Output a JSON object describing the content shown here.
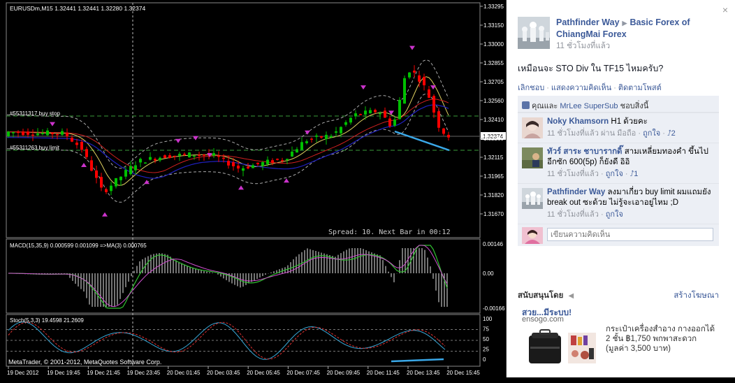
{
  "chart": {
    "header": "EURUSDm,M15  1.32441 1.32441 1.32280 1.32374",
    "price_labels": [
      "1.33295",
      "1.33150",
      "1.33000",
      "1.32855",
      "1.32705",
      "1.32560",
      "1.32410",
      "1.32374",
      "1.32260",
      "1.32115",
      "1.31965",
      "1.31820",
      "1.31670"
    ],
    "current_price": "1.32374",
    "buy_stop_label": "#55311317 buy stop",
    "buy_limit_label": "#55311263 buy limit",
    "spread_text": "Spread: 10. Next Bar in 00:12",
    "macd_label": "MACD(15,35,9) 0.000599 0.001099  =>MA(3) 0.000765",
    "macd_scale": [
      "0.00146",
      "0.00",
      "-0.00166"
    ],
    "stoch_label": "Stoch(5,3,3) 19.4598 21.2609",
    "stoch_scale": [
      "100",
      "75",
      "50",
      "25",
      "0"
    ],
    "copyright": "MetaTrader, © 2001-2012, MetaQuotes Software Corp.",
    "time_labels": [
      "19 Dec 2012",
      "19 Dec 19:45",
      "19 Dec 21:45",
      "19 Dec 23:45",
      "20 Dec 01:45",
      "20 Dec 03:45",
      "20 Dec 05:45",
      "20 Dec 07:45",
      "20 Dec 09:45",
      "20 Dec 11:45",
      "20 Dec 13:45",
      "20 Dec 15:45"
    ],
    "colors": {
      "bull": "#00c000",
      "bear": "#ff0000",
      "fractal": "#cc33cc",
      "level": "#3a9b3a",
      "trend": "#3aa8e8",
      "ma_yellow": "#e0d060",
      "ma_red": "#d02020",
      "ma_blue": "#2020c0"
    }
  },
  "fb": {
    "close_glyph": "×",
    "page_name": "Pathfinder Way",
    "arrow_glyph": "▶",
    "group_name": "Basic Forex of ChiangMai Forex",
    "post_time": "11 ชั่วโมงที่แล้ว",
    "post_text": "เหมือนจะ STO Div ใน TF15 ไหมครับ?",
    "actions": [
      "เลิกชอบ",
      "แสดงความคิดเห็น",
      "ติดตามโพสต์"
    ],
    "action_sep": "·",
    "likes_prefix": "คุณและ",
    "likes_name": "MrLee SuperSub",
    "likes_suffix": "ชอบสิ่งนี้",
    "comments": [
      {
        "name": "Noky Khamsorn",
        "text": "H1 ด้วยคะ",
        "time": "11 ชั่วโมงที่แล้ว ผ่าน มือถือ",
        "like": "ถูกใจ",
        "count": "2"
      },
      {
        "name": "ทัวร์ สาระ ชาบารากดิ๊",
        "text": "สามเหลี่ยมทองคำ ขึ้นไปอีกซัก 600(5p) ก็ยังดี อิอิ",
        "time": "11 ชั่วโมงที่แล้ว",
        "like": "ถูกใจ",
        "count": "1"
      },
      {
        "name": "Pathfinder Way",
        "text": "ลงมาเกี่ยว buy limit ผมแถมยัง break out ซะด้วย ไม่รู้จะเอาอยู่ไหม ;D",
        "time": "11 ชั่วโมงที่แล้ว",
        "like": "ถูกใจ",
        "count": ""
      }
    ],
    "like_glyph": "⭜",
    "comment_placeholder": "เขียนความคิดเห็น",
    "sponsor_label": "สนับสนุนโดย",
    "create_ad": "สร้างโฆษณา",
    "ad_title": "สวย...มีระบบ!",
    "ad_domain": "ensogo.com",
    "ad_text": "กระเป๋าเครื่องสำอาง กางออกได้ 2 ชั้น ฿1,750 พกพาสะดวก (มูลค่า 3,500 บาท)"
  }
}
